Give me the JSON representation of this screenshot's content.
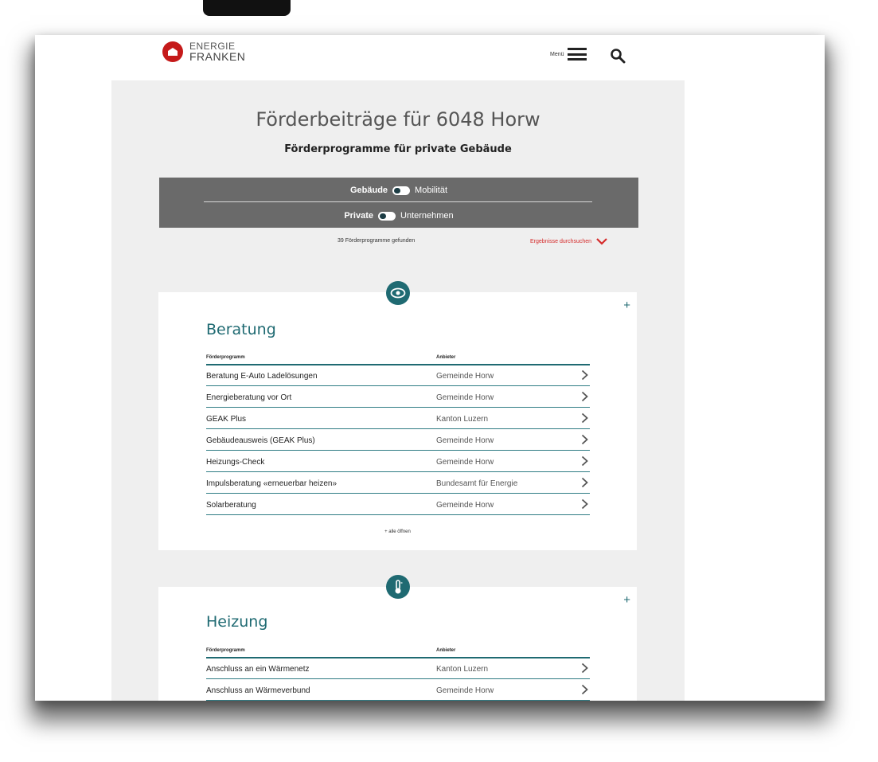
{
  "header": {
    "logo_line1": "ENERGIE",
    "logo_line2": "FRANKEN",
    "menu_label": "Menü"
  },
  "main": {
    "title": "Förderbeiträge für 6048 Horw",
    "subtitle": "Förderprogramme für private Gebäude"
  },
  "filters": {
    "toggle1_left": "Gebäude",
    "toggle1_right": "Mobilität",
    "toggle2_left": "Private",
    "toggle2_right": "Unternehmen"
  },
  "results": {
    "count_text": "39 Förderprogramme gefunden",
    "browse_label": "Ergebnisse durchsuchen"
  },
  "colors": {
    "accent": "#1f6a72",
    "brand_red": "#c51a1a",
    "filter_bg": "#6a6a6a"
  },
  "sections": [
    {
      "title": "Beratung",
      "icon": "eye-icon",
      "col_program": "Förderprogramm",
      "col_provider": "Anbieter",
      "rows": [
        {
          "name": "Beratung E-Auto Ladelösungen",
          "provider": "Gemeinde Horw"
        },
        {
          "name": "Energieberatung vor Ort",
          "provider": "Gemeinde Horw"
        },
        {
          "name": "GEAK Plus",
          "provider": "Kanton Luzern"
        },
        {
          "name": "Gebäudeausweis (GEAK Plus)",
          "provider": "Gemeinde Horw"
        },
        {
          "name": "Heizungs-Check",
          "provider": "Gemeinde Horw"
        },
        {
          "name": "Impulsberatung «erneuerbar heizen»",
          "provider": "Bundesamt für Energie"
        },
        {
          "name": "Solarberatung",
          "provider": "Gemeinde Horw"
        }
      ],
      "open_all": "+ alle öffnen",
      "plus": "+"
    },
    {
      "title": "Heizung",
      "icon": "thermometer-icon",
      "col_program": "Förderprogramm",
      "col_provider": "Anbieter",
      "rows": [
        {
          "name": "Anschluss an ein Wärmenetz",
          "provider": "Kanton Luzern"
        },
        {
          "name": "Anschluss an Wärmeverbund",
          "provider": "Gemeinde Horw"
        }
      ],
      "plus": "+"
    }
  ]
}
